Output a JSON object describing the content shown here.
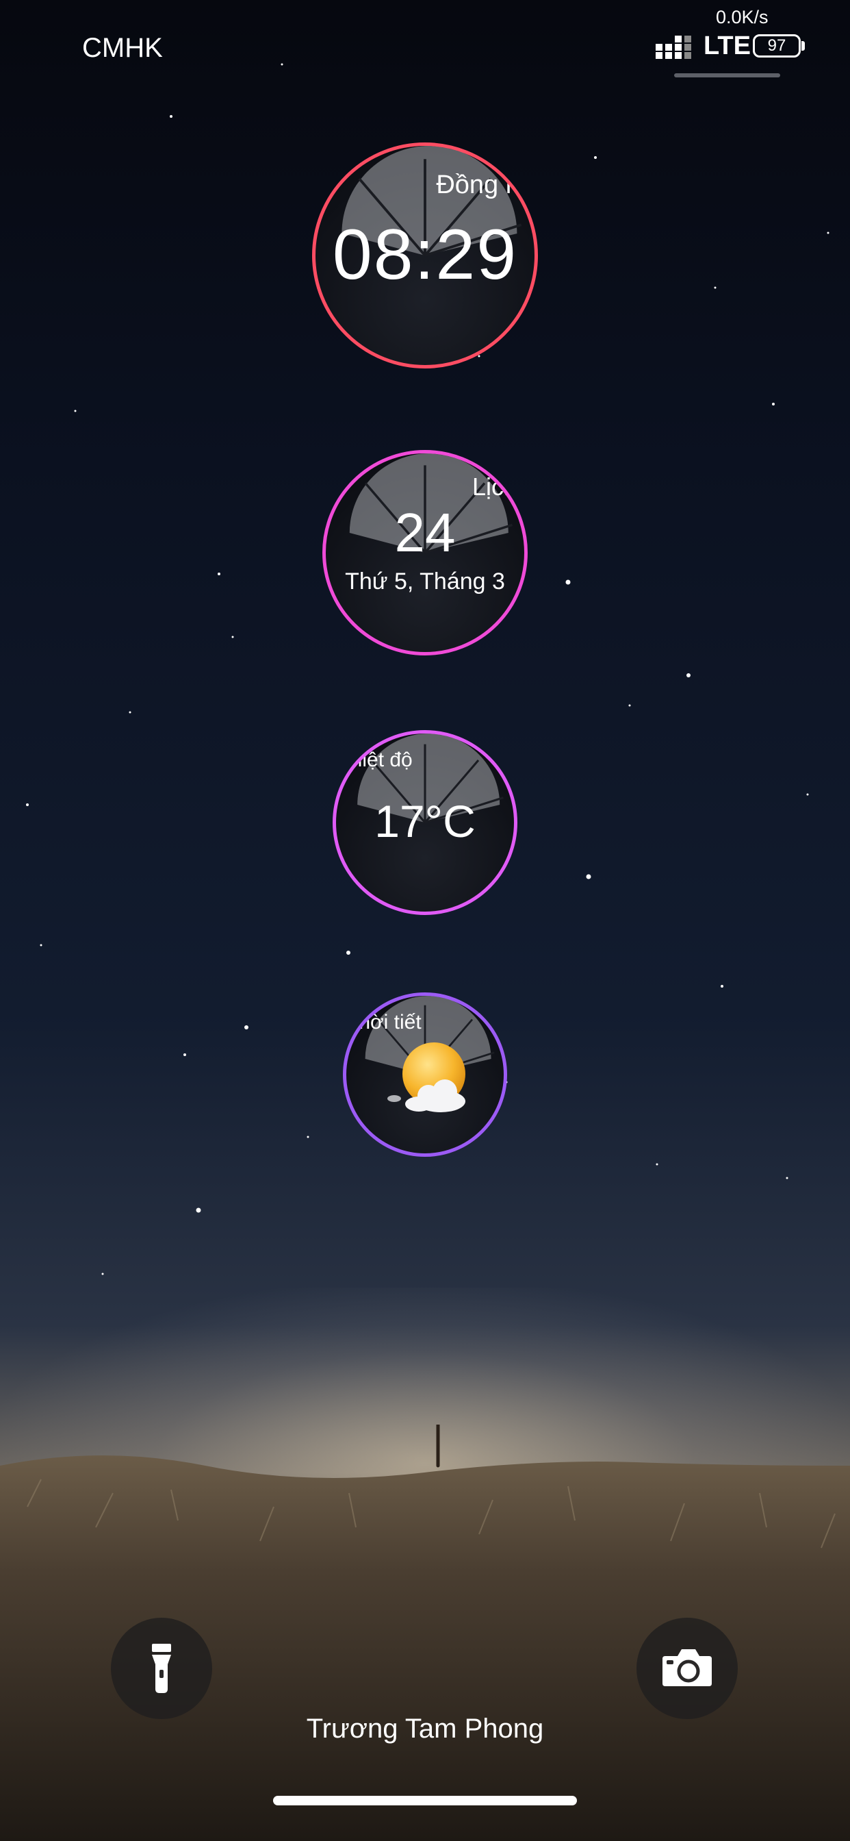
{
  "status_bar": {
    "carrier": "CMHK",
    "net_speed": "0.0K/s",
    "network": "LTE",
    "battery": "97",
    "signal_icon": "signal-bars-icon"
  },
  "widgets": {
    "clock": {
      "title": "Đồng hồ",
      "time": "08:29",
      "accent": "#ff4d63"
    },
    "calendar": {
      "title": "Lịch",
      "day": "24",
      "date_label": "Thứ 5, Tháng 3",
      "accent": "#f04bd8"
    },
    "temperature": {
      "title": "Nhiệt độ",
      "value": "17°C",
      "accent": "#e05bf6"
    },
    "weather": {
      "title": "Thời tiết",
      "icon": "sun-cloud-icon",
      "accent": "#9c5bf5"
    }
  },
  "bottom": {
    "flashlight_icon": "flashlight-icon",
    "camera_icon": "camera-icon",
    "owner": "Trương Tam Phong"
  }
}
